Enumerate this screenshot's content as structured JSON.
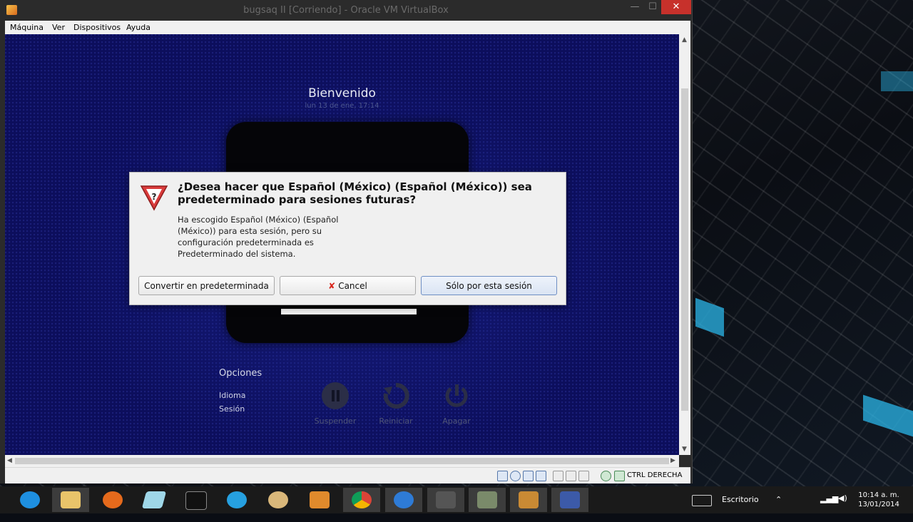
{
  "window": {
    "title": "bugsaq II [Corriendo] - Oracle VM VirtualBox",
    "close_glyph": "✕",
    "minimize_glyph": "—",
    "maximize_glyph": "☐",
    "menu": [
      "Máquina",
      "Ver",
      "Dispositivos",
      "Ayuda"
    ]
  },
  "guest": {
    "welcome": "Bienvenido",
    "date": "lun 13 de ene, 17:14",
    "options_heading": "Opciones",
    "options": [
      "Idioma",
      "Sesión"
    ],
    "power_buttons": [
      "Suspender",
      "Reiniciar",
      "Apagar"
    ]
  },
  "dialog": {
    "title": "¿Desea hacer que Español (México) (Español (México)) sea predeterminado para sesiones futuras?",
    "body": "Ha escogido Español (México) (Español (México)) para esta sesión, pero su configuración predeterminada es Predeterminado del sistema.",
    "buttons": {
      "make_default": "Convertir en predeterminada",
      "cancel": "Cancel",
      "this_session": "Sólo por esta sesión"
    },
    "icon": "warning-triangle-icon"
  },
  "statusbar": {
    "host_key": "CTRL DERECHA"
  },
  "taskbar": {
    "apps": [
      "internet-explorer-icon",
      "file-explorer-icon",
      "firefox-icon",
      "app-icon",
      "command-prompt-icon",
      "app-icon",
      "paint-icon",
      "media-player-icon",
      "chrome-icon",
      "app-icon",
      "app-icon",
      "app-icon",
      "app-icon",
      "virtualbox-icon"
    ],
    "desktop_label": "Escritorio",
    "time": "10:14 a. m.",
    "date": "13/01/2014"
  },
  "colors": {
    "guest_bg": "#0c0e5c",
    "dialog_bg": "#f0f0f0",
    "close_red": "#c7312b",
    "accent_blue": "#2bb6e8"
  }
}
